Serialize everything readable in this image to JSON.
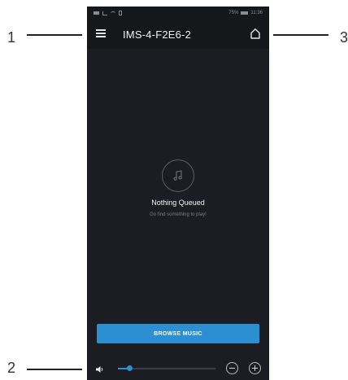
{
  "callouts": {
    "c1": "1",
    "c2": "2",
    "c3": "3"
  },
  "status_bar": {
    "time": "11:36",
    "battery": "75%"
  },
  "header": {
    "title": "IMS-4-F2E6-2",
    "menu_icon": "hamburger-menu-icon",
    "home_icon": "home-icon"
  },
  "empty_state": {
    "icon": "music-note-icon",
    "title": "Nothing Queued",
    "subtitle": "Go find something to play!"
  },
  "browse_button": {
    "label": "BROWSE MUSIC"
  },
  "volume": {
    "level_fraction": 0.12,
    "speaker_icon": "speaker-icon",
    "down_icon": "minus-circle-icon",
    "up_icon": "plus-circle-icon"
  },
  "colors": {
    "background": "#1b1d22",
    "accent": "#2b8fd1",
    "header": "#15171b"
  }
}
